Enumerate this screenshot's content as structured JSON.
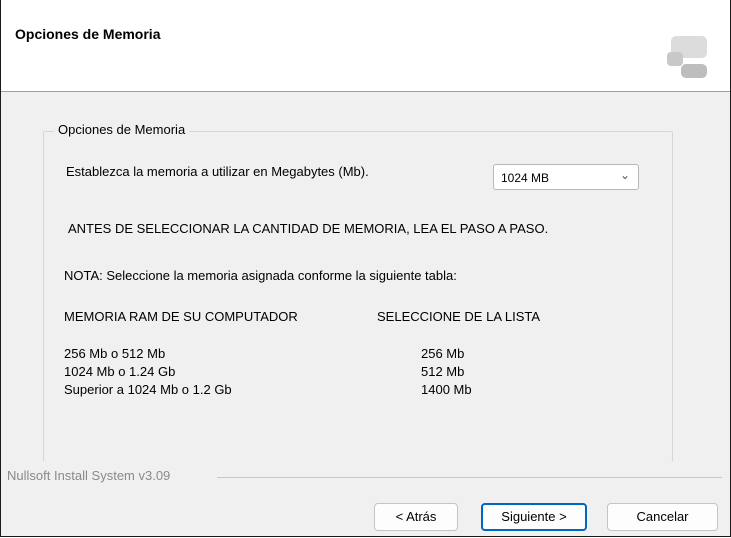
{
  "header": {
    "title": "Opciones de Memoria"
  },
  "group": {
    "label": "Opciones de Memoria"
  },
  "memory": {
    "prompt": "Establezca la memoria a utilizar en Megabytes (Mb).",
    "selected": "1024 MB",
    "warning": "ANTES DE SELECCIONAR LA CANTIDAD DE MEMORIA, LEA EL PASO A PASO.",
    "note": "NOTA: Seleccione la memoria asignada conforme la siguiente tabla:"
  },
  "table": {
    "headers": [
      "MEMORIA RAM DE SU COMPUTADOR",
      "SELECCIONE DE LA LISTA"
    ],
    "rows": [
      [
        "256  Mb o 512 Mb",
        "256 Mb"
      ],
      [
        "1024 Mb o 1.24 Gb",
        "512 Mb"
      ],
      [
        "Superior a 1024 Mb o 1.2 Gb",
        "1400 Mb"
      ]
    ]
  },
  "footer": {
    "brand": "Nullsoft Install System v3.09",
    "back_label": "< Atrás",
    "next_label": "Siguiente >",
    "cancel_label": "Cancelar"
  }
}
